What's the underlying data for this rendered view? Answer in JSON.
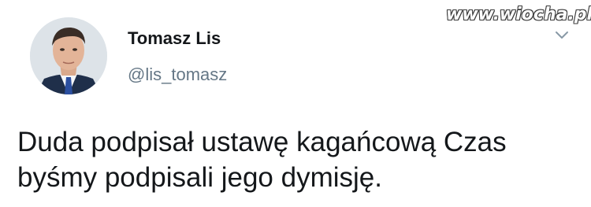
{
  "watermark": "www.wiocha.pl",
  "tweet": {
    "author_name": "Tomasz Lis",
    "author_handle": "@lis_tomasz",
    "text_lines": [
      "Duda podpisał ustawę kagańcową Czas",
      "byśmy podpisali jego dymisję."
    ]
  },
  "icons": {
    "avatar": "avatar-photo",
    "menu": "chevron-down-icon"
  },
  "colors": {
    "name": "#14171a",
    "handle": "#657786",
    "text": "#14171a",
    "chevron": "#8899a6"
  }
}
